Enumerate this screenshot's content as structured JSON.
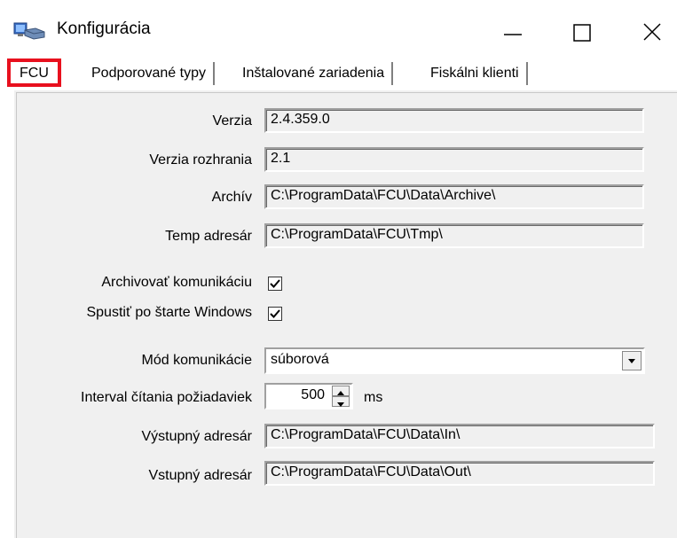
{
  "window": {
    "title": "Konfigurácia"
  },
  "tabs": [
    {
      "label": "FCU",
      "active": true
    },
    {
      "label": "Podporované typy",
      "active": false
    },
    {
      "label": "Inštalované zariadenia",
      "active": false
    },
    {
      "label": "Fiskálni klienti",
      "active": false
    }
  ],
  "form": {
    "verzia": {
      "label": "Verzia",
      "value": "2.4.359.0"
    },
    "verzia_rozhrania": {
      "label": "Verzia rozhrania",
      "value": "2.1"
    },
    "archiv": {
      "label": "Archív",
      "value": "C:\\ProgramData\\FCU\\Data\\Archive\\"
    },
    "temp": {
      "label": "Temp adresár",
      "value": "C:\\ProgramData\\FCU\\Tmp\\"
    },
    "archivovat": {
      "label": "Archivovať komunikáciu",
      "checked": true
    },
    "spustit": {
      "label": "Spustiť po štarte Windows",
      "checked": true
    },
    "mod": {
      "label": "Mód komunikácie",
      "value": "súborová"
    },
    "interval": {
      "label": "Interval čítania požiadaviek",
      "value": "500",
      "unit": "ms"
    },
    "vystupny": {
      "label": "Výstupný adresár",
      "value": "C:\\ProgramData\\FCU\\Data\\In\\"
    },
    "vstupny": {
      "label": "Vstupný adresár",
      "value": "C:\\ProgramData\\FCU\\Data\\Out\\"
    }
  },
  "colors": {
    "highlight": "#e8101e",
    "panel_bg": "#f0f0f0"
  },
  "icons": [
    "app-icon",
    "minimize-icon",
    "maximize-icon",
    "close-icon",
    "checkmark-icon",
    "dropdown-arrow-icon",
    "spin-up-icon",
    "spin-down-icon"
  ]
}
